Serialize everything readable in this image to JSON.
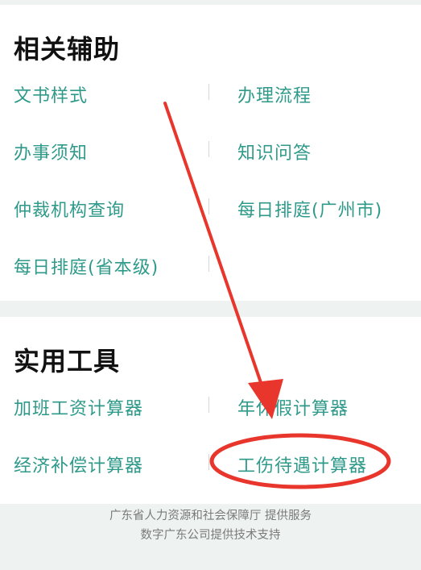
{
  "related": {
    "title": "相关辅助",
    "items": [
      "文书样式",
      "办理流程",
      "办事须知",
      "知识问答",
      "仲裁机构查询",
      "每日排庭(广州市)",
      "每日排庭(省本级)"
    ]
  },
  "tools": {
    "title": "实用工具",
    "items": [
      "加班工资计算器",
      "年休假计算器",
      "经济补偿计算器",
      "工伤待遇计算器"
    ]
  },
  "footer": {
    "line1": "广东省人力资源和社会保障厅 提供服务",
    "line2": "数字广东公司提供技术支持"
  },
  "annotation_color": "#e8362d"
}
